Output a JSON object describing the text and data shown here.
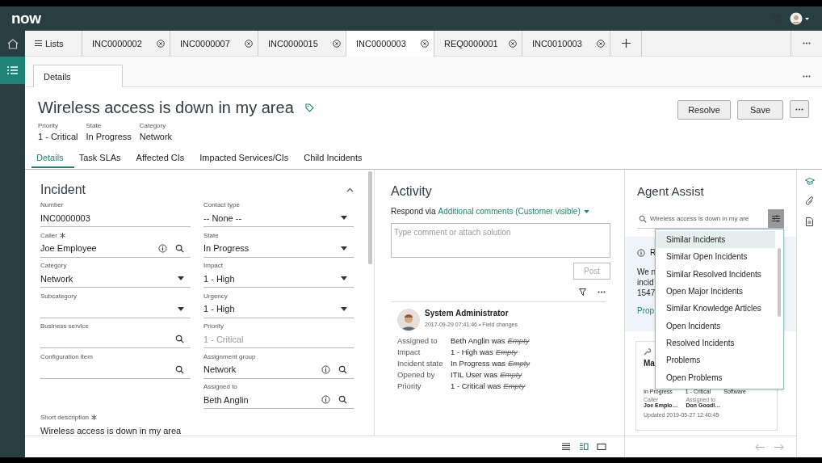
{
  "app": {
    "logo": "now"
  },
  "tabs": [
    {
      "label": "Lists",
      "kind": "lists",
      "selected": false
    },
    {
      "label": "INC0000002",
      "kind": "record",
      "selected": false
    },
    {
      "label": "INC0000007",
      "kind": "record",
      "selected": false
    },
    {
      "label": "INC0000015",
      "kind": "record",
      "selected": false
    },
    {
      "label": "INC0000003",
      "kind": "record",
      "selected": true
    },
    {
      "label": "REQ0000001",
      "kind": "record",
      "selected": false
    },
    {
      "label": "INC0010003",
      "kind": "record",
      "selected": false
    }
  ],
  "subtabs": [
    {
      "label": "Details",
      "selected": true
    }
  ],
  "record": {
    "title": "Wireless access is down in my area",
    "summary": [
      {
        "label": "Priority",
        "value": "1 - Critical"
      },
      {
        "label": "State",
        "value": "In Progress"
      },
      {
        "label": "Category",
        "value": "Network"
      }
    ],
    "buttons": [
      "Resolve",
      "Save"
    ]
  },
  "section_tabs": [
    {
      "label": "Details",
      "selected": true
    },
    {
      "label": "Task SLAs",
      "selected": false
    },
    {
      "label": "Affected CIs",
      "selected": false
    },
    {
      "label": "Impacted Services/CIs",
      "selected": false
    },
    {
      "label": "Child Incidents",
      "selected": false
    }
  ],
  "form": {
    "title": "Incident",
    "left": [
      {
        "label": "Number",
        "kind": "text",
        "value": "INC0000003",
        "required": false
      },
      {
        "label": "Caller",
        "kind": "lookup",
        "value": "Joe Employee",
        "required": true,
        "info": true
      },
      {
        "label": "Category",
        "kind": "select",
        "value": "Network",
        "required": false
      },
      {
        "label": "Subcategory",
        "kind": "select",
        "required": false
      },
      {
        "label": "Business service",
        "kind": "lookup",
        "required": false,
        "info": false
      },
      {
        "label": "Configuration item",
        "kind": "lookup",
        "required": false,
        "info": false
      }
    ],
    "right": [
      {
        "label": "Contact type",
        "kind": "select",
        "value": "-- None --",
        "required": false
      },
      {
        "label": "State",
        "kind": "select",
        "value": "In Progress",
        "required": false
      },
      {
        "label": "Impact",
        "kind": "select",
        "value": "1 - High",
        "required": false
      },
      {
        "label": "Urgency",
        "kind": "select",
        "value": "1 - High",
        "required": false
      },
      {
        "label": "Priority",
        "kind": "text",
        "value": "1 - Critical",
        "required": false,
        "readonly": true
      },
      {
        "label": "Assignment group",
        "kind": "lookup",
        "value": "Network",
        "required": false,
        "info": true
      },
      {
        "label": "Assigned to",
        "kind": "lookup",
        "value": "Beth Anglin",
        "required": false,
        "info": true
      }
    ],
    "full": [
      {
        "label": "Short description",
        "kind": "text",
        "value": "Wireless access is down in my area",
        "required": true
      }
    ]
  },
  "activity": {
    "title": "Activity",
    "respond_label": "Respond via",
    "respond_channel": "Additional comments (Customer visible)",
    "placeholder": "Type comment or attach solution",
    "post": {
      "label": "Post",
      "disabled": true
    },
    "entries": [
      {
        "author": "System Administrator",
        "meta": "2017-09-29 07:41:46 • Field changes",
        "changes": [
          {
            "field": "Assigned to",
            "value": "Beth Anglin was",
            "old": "Empty"
          },
          {
            "field": "Impact",
            "value": "1 - High was",
            "old": "Empty"
          },
          {
            "field": "Incident state",
            "value": "In Progress was",
            "old": "Empty"
          },
          {
            "field": "Opened by",
            "value": "ITIL User was",
            "old": "Empty"
          },
          {
            "field": "Priority",
            "value": "1 - Critical was",
            "old": "Empty"
          }
        ]
      }
    ]
  },
  "view_modes": [
    {
      "kind": "list",
      "selected": false
    },
    {
      "kind": "split",
      "selected": true
    },
    {
      "kind": "single",
      "selected": false
    }
  ],
  "agent_assist": {
    "title": "Agent Assist",
    "search_value": "Wireless access is down in my are",
    "recommendation": {
      "heading": "R",
      "lines": [
        "We n",
        "incid",
        "1547"
      ],
      "link": "Prop"
    },
    "card": {
      "title": "Ma",
      "values": [
        "In Progress",
        "1 - Critical",
        "Software"
      ],
      "fields": [
        {
          "label": "Caller",
          "value": "Joe Emplo…"
        },
        {
          "label": "Assigned to",
          "value": "Don Goodl…"
        }
      ],
      "updated": "Updated 2019-05-27 12:40:45"
    },
    "filter_menu": {
      "items": [
        {
          "label": "Similar Incidents",
          "selected": true
        },
        {
          "label": "Similar Open Incidents",
          "selected": false
        },
        {
          "label": "Similar Resolved Incidents",
          "selected": false
        },
        {
          "label": "Open Major Incidents",
          "selected": false
        },
        {
          "label": "Similar Knowledge Articles",
          "selected": false
        },
        {
          "label": "Open Incidents",
          "selected": false
        },
        {
          "label": "Resolved Incidents",
          "selected": false
        },
        {
          "label": "Problems",
          "selected": false
        },
        {
          "label": "Open Problems",
          "selected": false
        }
      ]
    }
  }
}
